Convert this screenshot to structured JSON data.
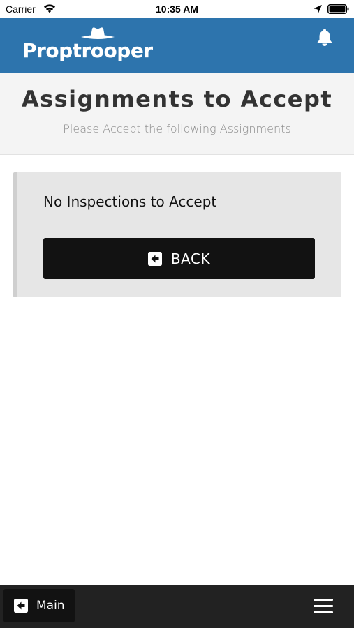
{
  "status_bar": {
    "carrier": "Carrier",
    "time": "10:35 AM",
    "icons": [
      "wifi-icon",
      "location-icon",
      "battery-icon"
    ]
  },
  "header": {
    "logo_text": "Proptrooper",
    "logo_icon": "hat-icon",
    "notification_icon": "bell-icon",
    "background_color": "#2d74ad"
  },
  "page": {
    "title": "Assignments to Accept",
    "subtitle": "Please Accept the following Assignments"
  },
  "card": {
    "message": "No Inspections to Accept",
    "back_button": {
      "label": "BACK",
      "icon": "arrow-left-square-icon"
    }
  },
  "bottom_bar": {
    "main_button": {
      "label": "Main",
      "icon": "arrow-left-square-icon"
    },
    "menu_icon": "hamburger-menu-icon"
  }
}
